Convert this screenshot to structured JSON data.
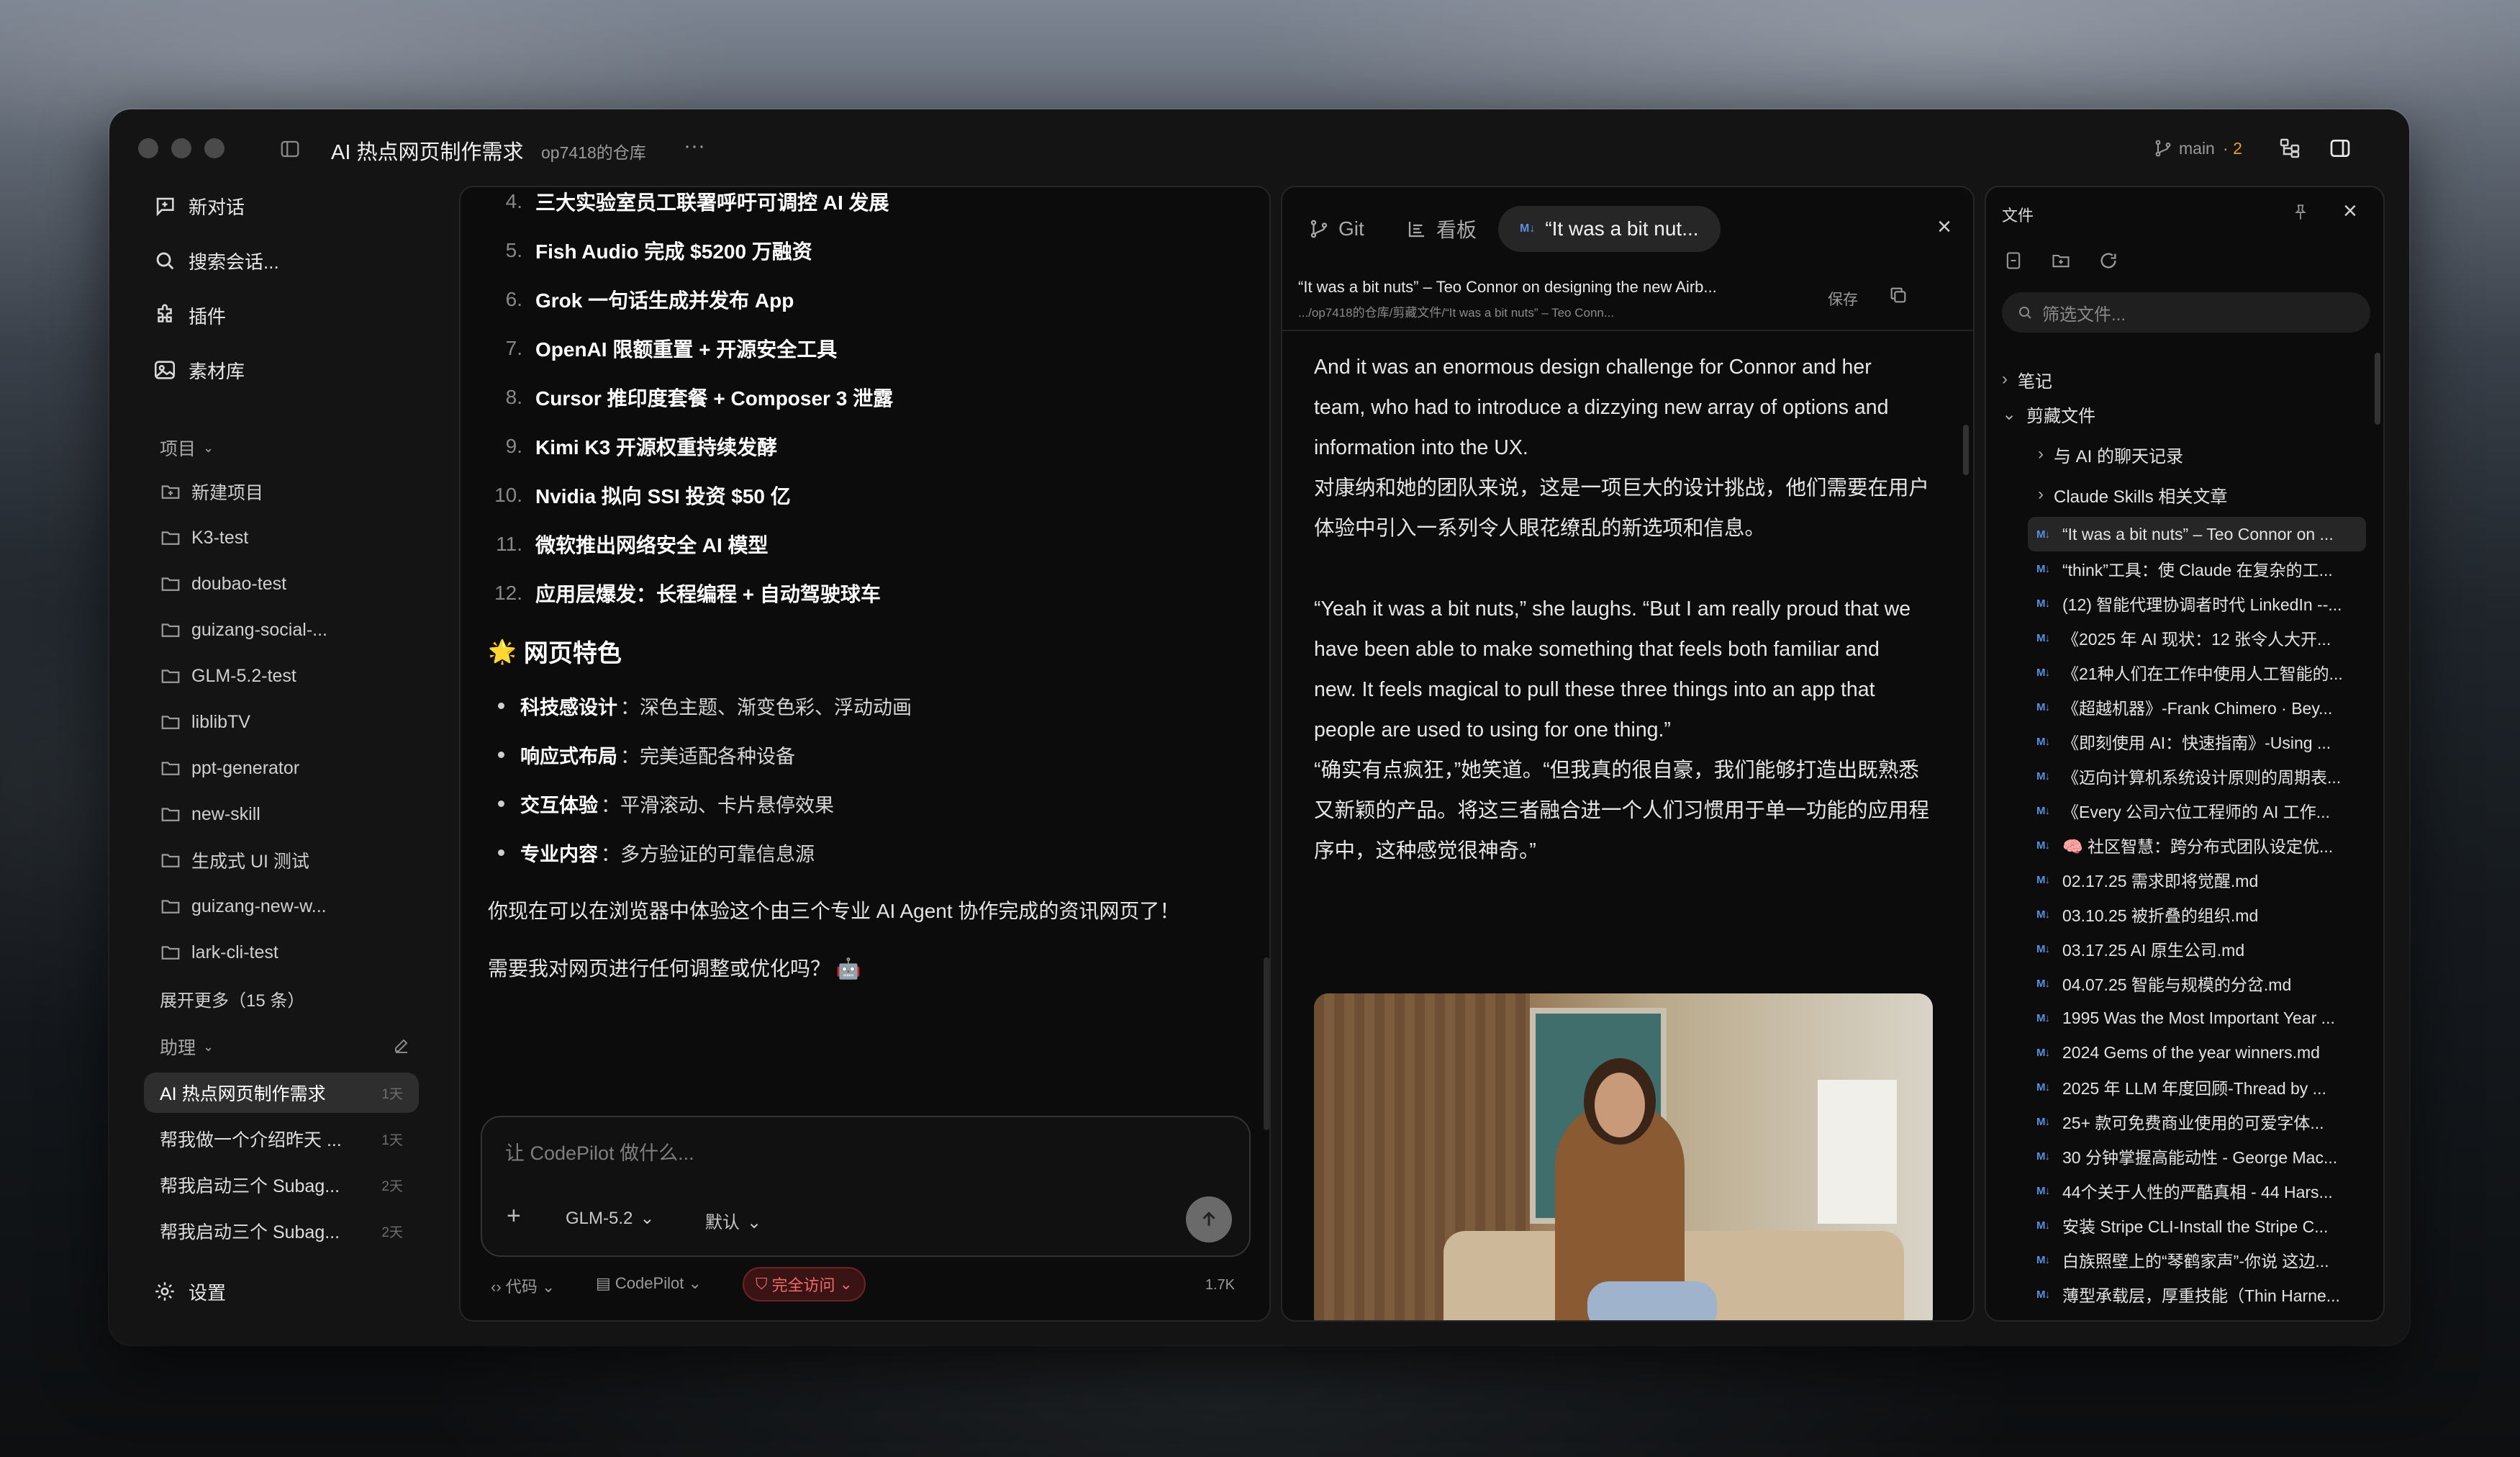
{
  "window": {
    "title": "AI 热点网页制作需求",
    "repo": "op7418的仓库",
    "branch": "main",
    "branch_changes": "2"
  },
  "sidebar": {
    "nav": [
      {
        "label": "新对话",
        "icon": "chat-plus-icon"
      },
      {
        "label": "搜索会话...",
        "icon": "search-icon"
      },
      {
        "label": "插件",
        "icon": "puzzle-icon"
      },
      {
        "label": "素材库",
        "icon": "image-icon"
      }
    ],
    "projects_header": "项目",
    "projects": [
      "新建项目",
      "K3-test",
      "doubao-test",
      "guizang-social-...",
      "GLM-5.2-test",
      "liblibTV",
      "ppt-generator",
      "new-skill",
      "生成式 UI 测试",
      "guizang-new-w...",
      "lark-cli-test"
    ],
    "expand_more": "展开更多（15 条）",
    "assistant_header": "助理",
    "chats": [
      {
        "title": "AI 热点网页制作需求",
        "time": "1天"
      },
      {
        "title": "帮我做一个介绍昨天 ...",
        "time": "1天"
      },
      {
        "title": "帮我启动三个 Subag...",
        "time": "2天"
      },
      {
        "title": "帮我启动三个 Subag...",
        "time": "2天"
      }
    ],
    "settings": "设置"
  },
  "chat": {
    "items": [
      {
        "n": "4.",
        "text": "三大实验室员工联署呼吁可调控 AI 发展"
      },
      {
        "n": "5.",
        "text": "Fish Audio 完成 $5200 万融资"
      },
      {
        "n": "6.",
        "text": "Grok 一句话生成并发布 App"
      },
      {
        "n": "7.",
        "text": "OpenAI 限额重置 + 开源安全工具"
      },
      {
        "n": "8.",
        "text": "Cursor 推印度套餐 + Composer 3 泄露"
      },
      {
        "n": "9.",
        "text": "Kimi K3 开源权重持续发酵"
      },
      {
        "n": "10.",
        "text": "Nvidia 拟向 SSI 投资 $50 亿"
      },
      {
        "n": "11.",
        "text": "微软推出网络安全 AI 模型"
      },
      {
        "n": "12.",
        "text": "应用层爆发：长程编程 + 自动驾驶球车"
      }
    ],
    "section_emoji": "🌟",
    "section_title": "网页特色",
    "features": [
      {
        "bold": "科技感设计",
        "text": "：深色主题、渐变色彩、浮动动画"
      },
      {
        "bold": "响应式布局",
        "text": "：完美适配各种设备"
      },
      {
        "bold": "交互体验",
        "text": "：平滑滚动、卡片悬停效果"
      },
      {
        "bold": "专业内容",
        "text": "：多方验证的可靠信息源"
      }
    ],
    "closing": "你现在可以在浏览器中体验这个由三个专业 AI Agent 协作完成的资讯网页了！",
    "question": "需要我对网页进行任何调整或优化吗？ 🤖",
    "composer": {
      "placeholder": "让 CodePilot 做什么...",
      "model": "GLM-5.2",
      "mode": "默认"
    },
    "footer": {
      "code": "代码",
      "agent": "CodePilot",
      "access": "完全访问",
      "tokens": "1.7K"
    }
  },
  "preview": {
    "tabs": [
      {
        "label": "Git"
      },
      {
        "label": "看板"
      },
      {
        "label": "“It was a bit nut..."
      }
    ],
    "doc_title": "“It was a bit nuts” – Teo Connor on designing the new Airb...",
    "doc_path": ".../op7418的仓库/剪藏文件/“It was a bit nuts” – Teo Conn...",
    "save": "保存",
    "paragraphs": [
      [
        "And it was an enormous design challenge for Connor and her",
        "team, who had to introduce a dizzying new array of options and",
        "information into the UX.",
        "对康纳和她的团队来说，这是一项巨大的设计挑战，他们需要在用户",
        "体验中引入一系列令人眼花缭乱的新选项和信息。"
      ],
      [
        "“Yeah it was a bit nuts,” she laughs. “But I am really proud that we",
        "have been able to make something that feels both familiar and",
        "new. It feels magical to pull these three things into an app that",
        "people are used to using for one thing.”",
        "“确实有点疯狂，”她笑道。“但我真的很自豪，我们能够打造出既熟悉",
        "又新颖的产品。将这三者融合进一个人们习惯用于单一功能的应用程",
        "序中，这种感觉很神奇。”"
      ]
    ]
  },
  "files": {
    "title": "文件",
    "filter_placeholder": "筛选文件...",
    "folders": [
      {
        "label": "笔记"
      },
      {
        "label": "剪藏文件"
      },
      {
        "label": "与 AI 的聊天记录"
      },
      {
        "label": "Claude Skills 相关文章"
      }
    ],
    "items": [
      "“It was a bit nuts” – Teo Connor on ...",
      "“think”工具：使 Claude 在复杂的工...",
      "(12) 智能代理协调者时代 LinkedIn --...",
      "《2025 年 AI 现状：12 张令人大开...",
      "《21种人们在工作中使用人工智能的...",
      "《超越机器》-Frank Chimero · Bey...",
      "《即刻使用 AI：快速指南》-Using ...",
      "《迈向计算机系统设计原则的周期表...",
      "《Every 公司六位工程师的 AI 工作...",
      "🧠 社区智慧：跨分布式团队设定优...",
      "02.17.25 需求即将觉醒.md",
      "03.10.25 被折叠的组织.md",
      "03.17.25 AI 原生公司.md",
      "04.07.25 智能与规模的分岔.md",
      "1995 Was the Most Important Year ...",
      "2024 Gems of the year winners.md",
      "2025 年 LLM 年度回顾-Thread by ...",
      "25+ 款可免费商业使用的可爱字体...",
      "30 分钟掌握高能动性 - George Mac...",
      "44个关于人性的严酷真相 - 44 Hars...",
      "安装 Stripe CLI-Install the Stripe C...",
      "白族照壁上的“琴鹤家声”-你说 这边...",
      "薄型承载层，厚重技能（Thin Harne..."
    ]
  }
}
